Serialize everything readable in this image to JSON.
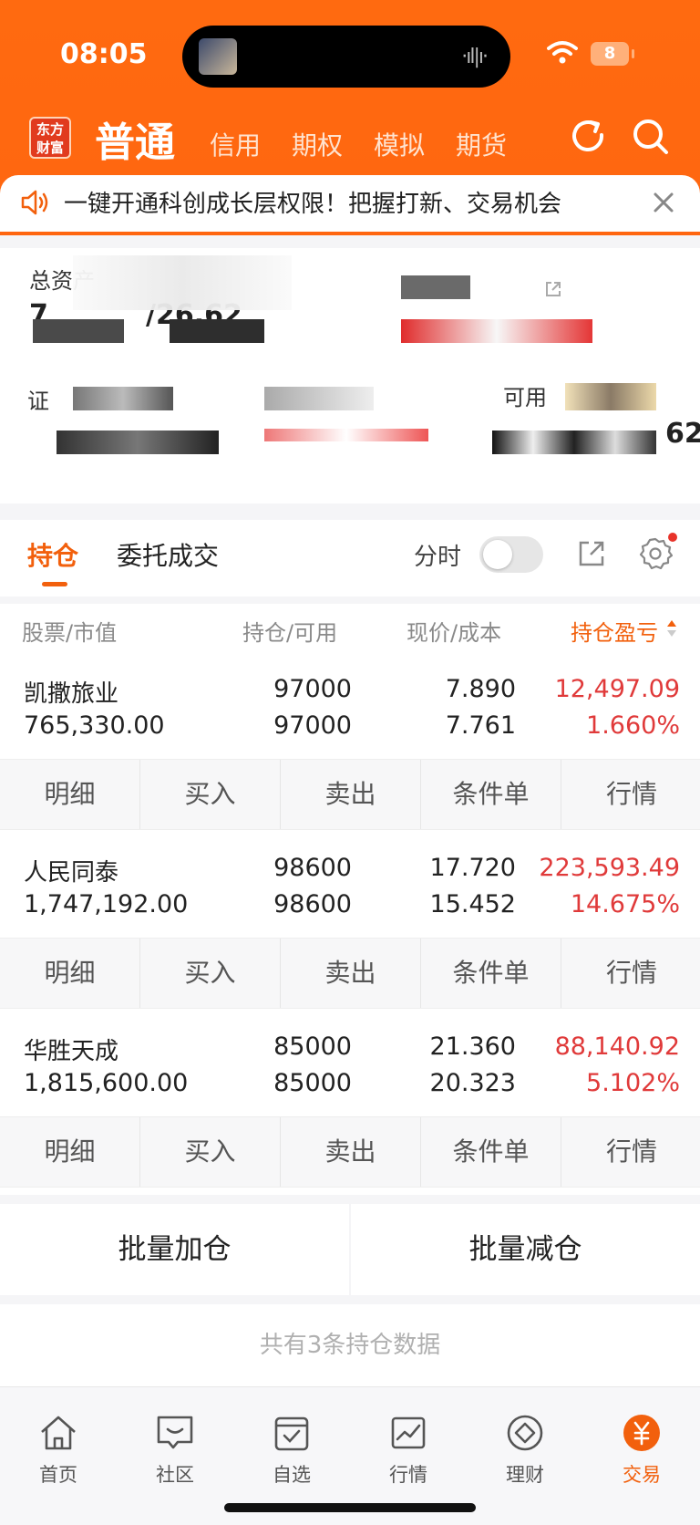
{
  "status_bar": {
    "time": "08:05",
    "battery": "8"
  },
  "header": {
    "logo_line1": "东方",
    "logo_line2": "财富",
    "tabs": [
      "普通",
      "信用",
      "期权",
      "模拟",
      "期货"
    ]
  },
  "notice": {
    "text": "一键开通科创成长层权限！把握打新、交易机会"
  },
  "assets": {
    "total_label": "总资产",
    "total_value_partial": "7",
    "total_value_tail": "/26.62",
    "securities_label": "证",
    "available_label": "可用",
    "available_tail": "62"
  },
  "positions": {
    "tab_holdings": "持仓",
    "tab_orders": "委托成交",
    "fenshi_label": "分时",
    "columns": {
      "stock": "股票",
      "market_value": "市值",
      "holding": "持仓",
      "available": "可用",
      "price": "现价",
      "cost": "成本",
      "pnl": "持仓盈亏"
    },
    "rows": [
      {
        "name": "凯撒旅业",
        "market_value": "765,330.00",
        "holding": "97000",
        "available": "97000",
        "price": "7.890",
        "cost": "7.761",
        "pnl": "12,497.09",
        "pnl_pct": "1.660%"
      },
      {
        "name": "人民同泰",
        "market_value": "1,747,192.00",
        "holding": "98600",
        "available": "98600",
        "price": "17.720",
        "cost": "15.452",
        "pnl": "223,593.49",
        "pnl_pct": "14.675%"
      },
      {
        "name": "华胜天成",
        "market_value": "1,815,600.00",
        "holding": "85000",
        "available": "85000",
        "price": "21.360",
        "cost": "20.323",
        "pnl": "88,140.92",
        "pnl_pct": "5.102%"
      }
    ],
    "actions": [
      "明细",
      "买入",
      "卖出",
      "条件单",
      "行情"
    ],
    "batch_add": "批量加仓",
    "batch_reduce": "批量减仓",
    "footer": "共有3条持仓数据"
  },
  "bottom_nav": [
    "首页",
    "社区",
    "自选",
    "行情",
    "理财",
    "交易"
  ],
  "colors": {
    "brand": "#ff6a10",
    "accent": "#f2600d",
    "gain": "#e03a3a"
  }
}
